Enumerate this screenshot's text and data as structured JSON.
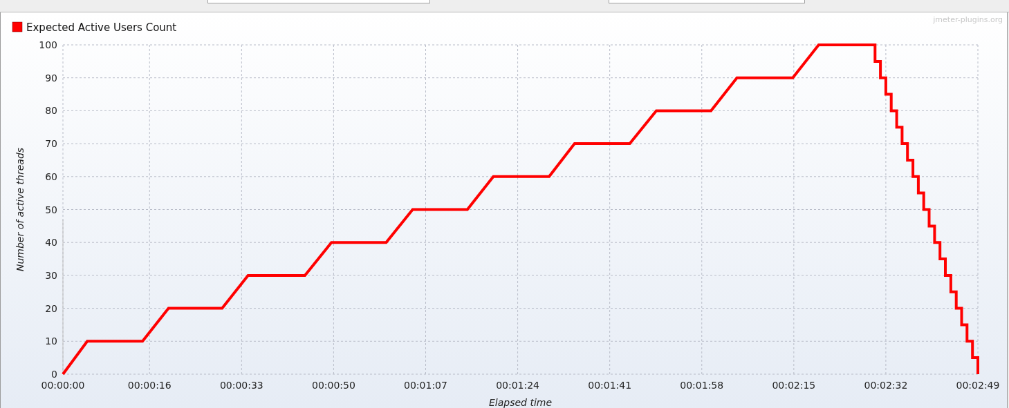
{
  "chart": {
    "credit": "jmeter-plugins.org",
    "chart_data": {
      "type": "line",
      "xlabel": "Elapsed time",
      "ylabel": "Number of active threads",
      "x": [
        0,
        4.5,
        14.7,
        19.5,
        29.4,
        34.2,
        44.7,
        49.6,
        59.7,
        64.6,
        74.7,
        79.5,
        89.8,
        94.5,
        104.7,
        109.6,
        119.7,
        124.5,
        134.8,
        139.6,
        150,
        150,
        151,
        151,
        152,
        152,
        153,
        153,
        154,
        154,
        155,
        155,
        156,
        156,
        157,
        157,
        158,
        158,
        159,
        159,
        160,
        160,
        161,
        161,
        162,
        162,
        163,
        163,
        164,
        164,
        165,
        165,
        166,
        166,
        167,
        167,
        168,
        168,
        169,
        169
      ],
      "series": [
        {
          "name": "Expected Active Users Count",
          "color": "#ff0000",
          "values": [
            0,
            10,
            10,
            20,
            20,
            30,
            30,
            40,
            40,
            50,
            50,
            60,
            60,
            70,
            70,
            80,
            80,
            90,
            90,
            100,
            100,
            95,
            95,
            90,
            90,
            85,
            85,
            80,
            80,
            75,
            75,
            70,
            70,
            65,
            65,
            60,
            60,
            55,
            55,
            50,
            50,
            45,
            45,
            40,
            40,
            35,
            35,
            30,
            30,
            25,
            25,
            20,
            20,
            15,
            15,
            10,
            10,
            5,
            5,
            0
          ]
        }
      ],
      "xlim": [
        0,
        169
      ],
      "ylim": [
        0,
        100
      ],
      "grid": true,
      "xticks": [
        {
          "value": 0,
          "label": "00:00:00"
        },
        {
          "value": 16,
          "label": "00:00:16"
        },
        {
          "value": 33,
          "label": "00:00:33"
        },
        {
          "value": 50,
          "label": "00:00:50"
        },
        {
          "value": 67,
          "label": "00:01:07"
        },
        {
          "value": 84,
          "label": "00:01:24"
        },
        {
          "value": 101,
          "label": "00:01:41"
        },
        {
          "value": 118,
          "label": "00:01:58"
        },
        {
          "value": 135,
          "label": "00:02:15"
        },
        {
          "value": 152,
          "label": "00:02:32"
        },
        {
          "value": 169,
          "label": "00:02:49"
        }
      ],
      "yticks": [
        0,
        10,
        20,
        30,
        40,
        50,
        60,
        70,
        80,
        90,
        100
      ]
    }
  }
}
